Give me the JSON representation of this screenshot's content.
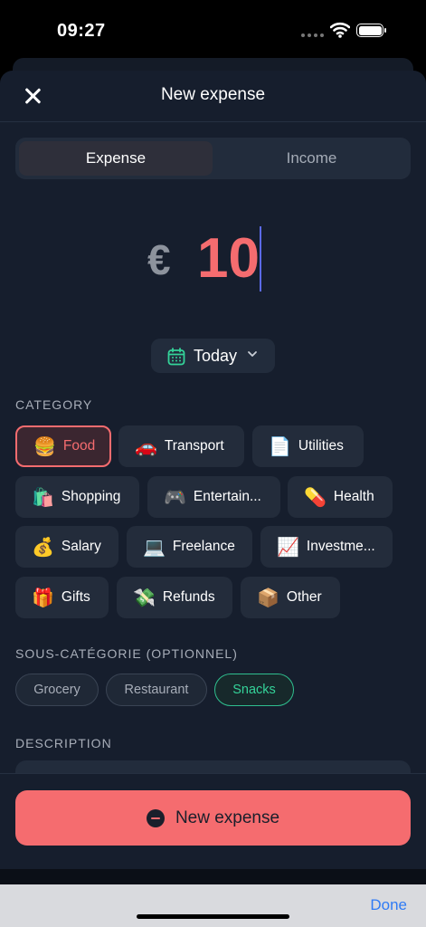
{
  "status": {
    "time": "09:27"
  },
  "header": {
    "title": "New expense",
    "close_icon": "close-icon"
  },
  "segment": {
    "expense": "Expense",
    "income": "Income",
    "selected": "Expense"
  },
  "amount": {
    "currency": "€",
    "value": "10"
  },
  "date": {
    "label": "Today",
    "icon": "calendar-icon"
  },
  "category": {
    "title": "CATEGORY",
    "selected": "Food",
    "items": [
      {
        "emoji": "🍔",
        "label": "Food"
      },
      {
        "emoji": "🚗",
        "label": "Transport"
      },
      {
        "emoji": "📄",
        "label": "Utilities"
      },
      {
        "emoji": "🛍️",
        "label": "Shopping"
      },
      {
        "emoji": "🎮",
        "label": "Entertain..."
      },
      {
        "emoji": "💊",
        "label": "Health"
      },
      {
        "emoji": "💰",
        "label": "Salary"
      },
      {
        "emoji": "💻",
        "label": "Freelance"
      },
      {
        "emoji": "📈",
        "label": "Investme..."
      },
      {
        "emoji": "🎁",
        "label": "Gifts"
      },
      {
        "emoji": "💸",
        "label": "Refunds"
      },
      {
        "emoji": "📦",
        "label": "Other"
      }
    ]
  },
  "subcategory": {
    "title": "SOUS-CATÉGORIE (OPTIONNEL)",
    "selected": "Snacks",
    "items": [
      "Grocery",
      "Restaurant",
      "Snacks"
    ]
  },
  "description": {
    "title": "DESCRIPTION"
  },
  "footer": {
    "button_label": "New expense"
  },
  "keyboard_toolbar": {
    "done": "Done"
  },
  "colors": {
    "accent": "#f56c6f",
    "selected_sub": "#34d399",
    "link": "#2f7bf5"
  }
}
